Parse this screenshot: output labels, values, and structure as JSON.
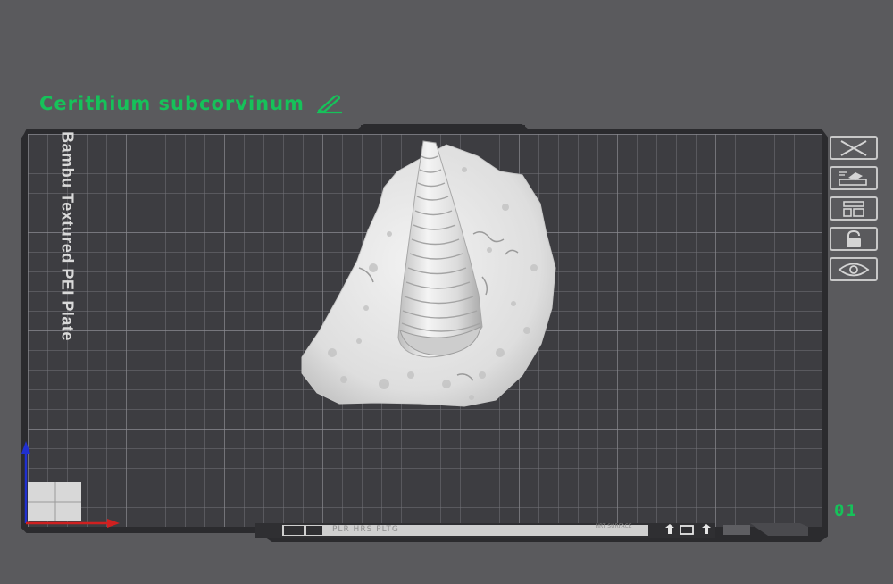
{
  "model": {
    "name": "Cerithium subcorvinum"
  },
  "plate": {
    "name": "Bambu Textured PEI Plate",
    "number": "01"
  },
  "plate_tools": [
    {
      "name": "close-plate",
      "icon": "close-icon"
    },
    {
      "name": "auto-arrange",
      "icon": "arrange-icon"
    },
    {
      "name": "plate-layout",
      "icon": "layout-icon"
    },
    {
      "name": "lock-plate",
      "icon": "lock-icon"
    },
    {
      "name": "preview-plate",
      "icon": "eye-icon"
    }
  ],
  "footer": {
    "label": "PLR HRS PLTG",
    "right_label": "HRT SURFACE"
  },
  "colors": {
    "accent": "#16c25a",
    "background": "#5a5a5d",
    "plate": "#3c3c40",
    "grid": "#7a7a7e",
    "model": "#e6e6e6",
    "axis_z": "#2030d0",
    "axis_x": "#d02020"
  }
}
